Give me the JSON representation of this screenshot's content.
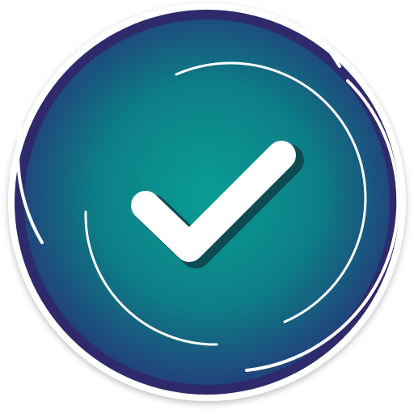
{
  "icon": {
    "name": "checkmark-badge-icon",
    "colors": {
      "outer": "#2E2A6B",
      "center": "#0A9D96",
      "mid": "#0C7F86",
      "edge": "#243A7A",
      "check": "#FFFFFF",
      "check_shadow": "#0E4C52",
      "arc": "#FFFFFF"
    }
  }
}
